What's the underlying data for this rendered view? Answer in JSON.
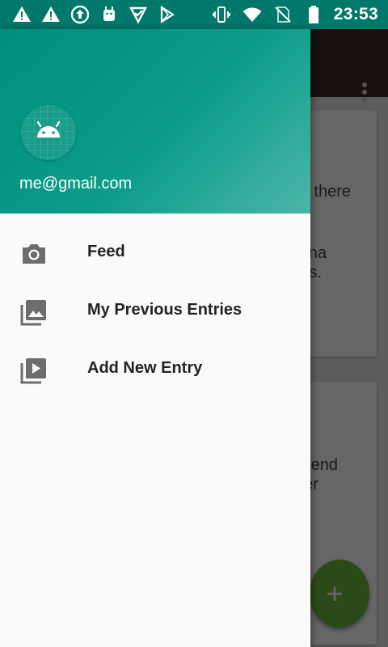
{
  "status_bar": {
    "time": "23:53",
    "notification_icons": [
      "warning-icon",
      "warning-icon",
      "upload-icon",
      "android-debug-icon",
      "check-list-icon",
      "play-store-icon"
    ],
    "system_icons": [
      "vibrate-icon",
      "wifi-icon",
      "no-sim-icon",
      "battery-icon"
    ],
    "color": "#00796b"
  },
  "background": {
    "card1_lines": [
      "there",
      "na",
      "s."
    ],
    "card2_lines": [
      "end",
      "er"
    ],
    "fab_label": "+"
  },
  "drawer": {
    "header": {
      "avatar_icon": "android-icon",
      "email": "me@gmail.com",
      "gradient": [
        "#008f7d",
        "#4cb6a8"
      ]
    },
    "items": [
      {
        "label": "Feed",
        "icon": "camera-icon"
      },
      {
        "label": "My Previous Entries",
        "icon": "photo-library-icon"
      },
      {
        "label": "Add New Entry",
        "icon": "video-library-icon"
      }
    ]
  }
}
